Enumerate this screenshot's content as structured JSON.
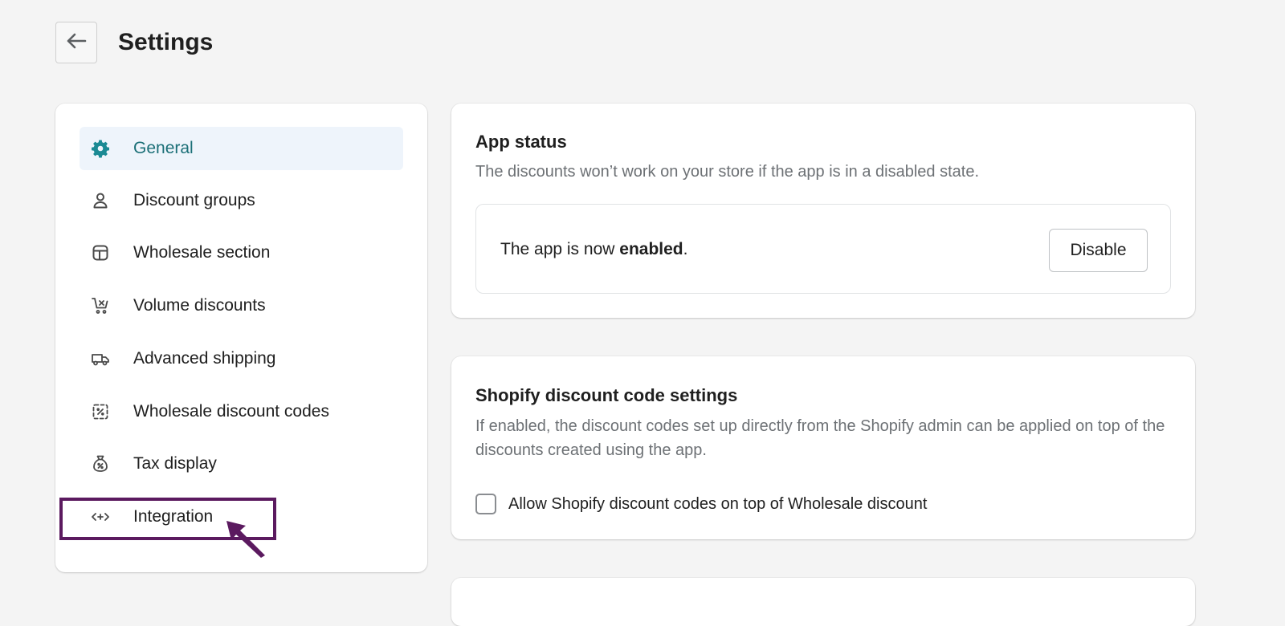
{
  "header": {
    "title": "Settings",
    "back_icon": "arrow-left-icon"
  },
  "sidebar": {
    "items": [
      {
        "label": "General",
        "icon": "gear-icon",
        "active": true
      },
      {
        "label": "Discount groups",
        "icon": "person-icon"
      },
      {
        "label": "Wholesale section",
        "icon": "layout-icon"
      },
      {
        "label": "Volume discounts",
        "icon": "cart-icon"
      },
      {
        "label": "Advanced shipping",
        "icon": "truck-icon"
      },
      {
        "label": "Wholesale discount codes",
        "icon": "discount-code-icon"
      },
      {
        "label": "Tax display",
        "icon": "money-bag-icon"
      },
      {
        "label": "Integration",
        "icon": "code-arrows-icon",
        "highlighted": true
      }
    ]
  },
  "app_status": {
    "title": "App status",
    "description": "The discounts won’t work on your store if the app is in a disabled state.",
    "status_prefix": "The app is now ",
    "status_value": "enabled",
    "status_suffix": ".",
    "disable_label": "Disable"
  },
  "discount_settings": {
    "title": "Shopify discount code settings",
    "description": "If enabled, the discount codes set up directly from the Shopify admin can be applied on top of the discounts created using the app.",
    "checkbox_label": "Allow Shopify discount codes on top of Wholesale discount",
    "checkbox_checked": false
  },
  "colors": {
    "accent": "#1b8a94",
    "active_bg": "#eef4fb",
    "annotation": "#5b1a5f"
  }
}
